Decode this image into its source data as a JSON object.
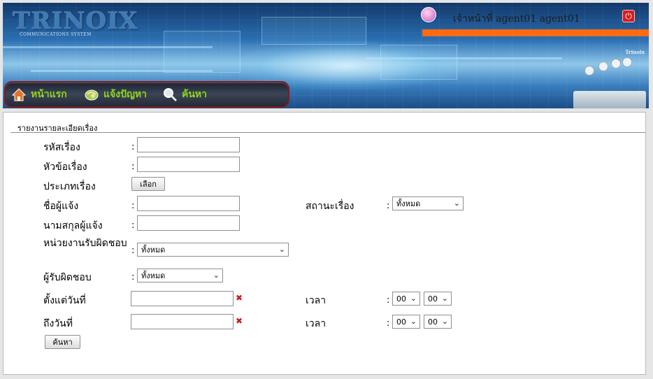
{
  "header": {
    "logo_text": "TRINOIX",
    "logo_subtitle": "COMMUNICATIONS SYSTEM",
    "brand_small": "Trinoix",
    "user_label": "เจ้าหน้าที่ agent01 agent01",
    "logout_icon": "power-icon"
  },
  "nav": {
    "items": [
      {
        "label": "หน้าแรก",
        "icon": "home-icon"
      },
      {
        "label": "แจ้งปัญหา",
        "icon": "report-icon"
      },
      {
        "label": "ค้นหา",
        "icon": "search-icon"
      }
    ]
  },
  "form": {
    "title": "รายงานรายละเอียดเรื่อง",
    "colon": ":",
    "fields": {
      "case_id": {
        "label": "รหัสเรื่อง",
        "value": ""
      },
      "subject": {
        "label": "หัวข้อเรื่อง",
        "value": ""
      },
      "case_type": {
        "label": "ประเภทเรื่อง",
        "button_label": "เลือก"
      },
      "reporter_first_name": {
        "label": "ชื่อผู้แจ้ง",
        "value": ""
      },
      "reporter_last_name": {
        "label": "นามสกุลผู้แจ้ง",
        "value": ""
      },
      "responsible_unit": {
        "label": "หน่วยงานรับผิดชอบ",
        "selected": "ทั้งหมด"
      },
      "assignee": {
        "label": "ผู้รับผิดชอบ",
        "selected": "ทั้งหมด"
      },
      "status": {
        "label": "สถานะเรื่อง",
        "selected": "ทั้งหมด"
      },
      "from_date": {
        "label": "ตั้งแต่วันที่",
        "value": "",
        "clear_icon": "clear-x-icon"
      },
      "to_date": {
        "label": "ถึงวันที่",
        "value": "",
        "clear_icon": "clear-x-icon"
      },
      "from_time": {
        "label": "เวลา",
        "hour": "00",
        "minute": "00"
      },
      "to_time": {
        "label": "เวลา",
        "hour": "00",
        "minute": "00"
      }
    },
    "search_button": "ค้นหา"
  },
  "colors": {
    "nav_text": "#8fd61c",
    "nav_border": "#8a1717",
    "accent_bar": "#ff6a13",
    "logout_red": "#d11e1e",
    "clear_red": "#c21f1f"
  }
}
